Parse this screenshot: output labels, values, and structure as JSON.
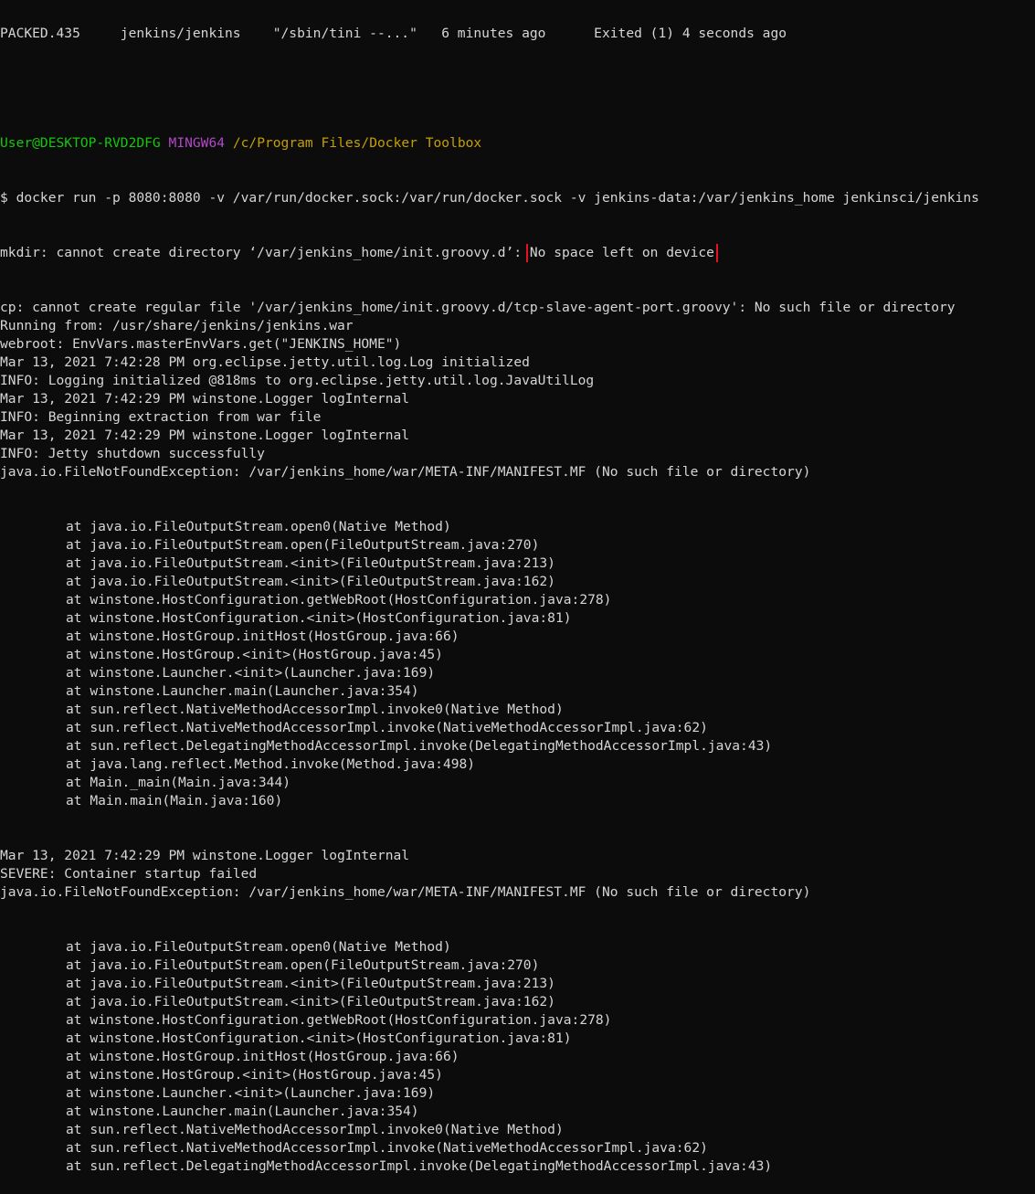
{
  "top_partial_line": "PACKED.435     jenkins/jenkins    \"/sbin/tini --...\"   6 minutes ago      Exited (1) 4 seconds ago",
  "prompt": {
    "user": "User@DESKTOP-RVD2DFG",
    "env": "MINGW64",
    "path": "/c/Program Files/Docker Toolbox"
  },
  "command": "$ docker run -p 8080:8080 -v /var/run/docker.sock:/var/run/docker.sock -v jenkins-data:/var/jenkins_home jenkinsci/jenkins",
  "mkdir_error": {
    "prefix": "mkdir: cannot create directory ‘/var/jenkins_home/init.groovy.d’: ",
    "highlighted": "No space left on device"
  },
  "output_lines": [
    "cp: cannot create regular file '/var/jenkins_home/init.groovy.d/tcp-slave-agent-port.groovy': No such file or directory",
    "Running from: /usr/share/jenkins/jenkins.war",
    "webroot: EnvVars.masterEnvVars.get(\"JENKINS_HOME\")",
    "Mar 13, 2021 7:42:28 PM org.eclipse.jetty.util.log.Log initialized",
    "INFO: Logging initialized @818ms to org.eclipse.jetty.util.log.JavaUtilLog",
    "Mar 13, 2021 7:42:29 PM winstone.Logger logInternal",
    "INFO: Beginning extraction from war file",
    "Mar 13, 2021 7:42:29 PM winstone.Logger logInternal",
    "INFO: Jetty shutdown successfully",
    "java.io.FileNotFoundException: /var/jenkins_home/war/META-INF/MANIFEST.MF (No such file or directory)"
  ],
  "stack_trace_1": [
    "at java.io.FileOutputStream.open0(Native Method)",
    "at java.io.FileOutputStream.open(FileOutputStream.java:270)",
    "at java.io.FileOutputStream.<init>(FileOutputStream.java:213)",
    "at java.io.FileOutputStream.<init>(FileOutputStream.java:162)",
    "at winstone.HostConfiguration.getWebRoot(HostConfiguration.java:278)",
    "at winstone.HostConfiguration.<init>(HostConfiguration.java:81)",
    "at winstone.HostGroup.initHost(HostGroup.java:66)",
    "at winstone.HostGroup.<init>(HostGroup.java:45)",
    "at winstone.Launcher.<init>(Launcher.java:169)",
    "at winstone.Launcher.main(Launcher.java:354)",
    "at sun.reflect.NativeMethodAccessorImpl.invoke0(Native Method)",
    "at sun.reflect.NativeMethodAccessorImpl.invoke(NativeMethodAccessorImpl.java:62)",
    "at sun.reflect.DelegatingMethodAccessorImpl.invoke(DelegatingMethodAccessorImpl.java:43)",
    "at java.lang.reflect.Method.invoke(Method.java:498)",
    "at Main._main(Main.java:344)",
    "at Main.main(Main.java:160)"
  ],
  "middle_lines": [
    "Mar 13, 2021 7:42:29 PM winstone.Logger logInternal",
    "SEVERE: Container startup failed",
    "java.io.FileNotFoundException: /var/jenkins_home/war/META-INF/MANIFEST.MF (No such file or directory)"
  ],
  "stack_trace_2": [
    "at java.io.FileOutputStream.open0(Native Method)",
    "at java.io.FileOutputStream.open(FileOutputStream.java:270)",
    "at java.io.FileOutputStream.<init>(FileOutputStream.java:213)",
    "at java.io.FileOutputStream.<init>(FileOutputStream.java:162)",
    "at winstone.HostConfiguration.getWebRoot(HostConfiguration.java:278)",
    "at winstone.HostConfiguration.<init>(HostConfiguration.java:81)",
    "at winstone.HostGroup.initHost(HostGroup.java:66)",
    "at winstone.HostGroup.<init>(HostGroup.java:45)",
    "at winstone.Launcher.<init>(Launcher.java:169)",
    "at winstone.Launcher.main(Launcher.java:354)",
    "at sun.reflect.NativeMethodAccessorImpl.invoke0(Native Method)",
    "at sun.reflect.NativeMethodAccessorImpl.invoke(NativeMethodAccessorImpl.java:62)",
    "at sun.reflect.DelegatingMethodAccessorImpl.invoke(DelegatingMethodAccessorImpl.java:43)"
  ],
  "colors": {
    "background": "#0c0c0c",
    "text": "#d6d6d6",
    "prompt_user": "#16c60c",
    "prompt_env": "#b148c6",
    "prompt_path": "#c4a000",
    "highlight_box": "#e81123"
  }
}
